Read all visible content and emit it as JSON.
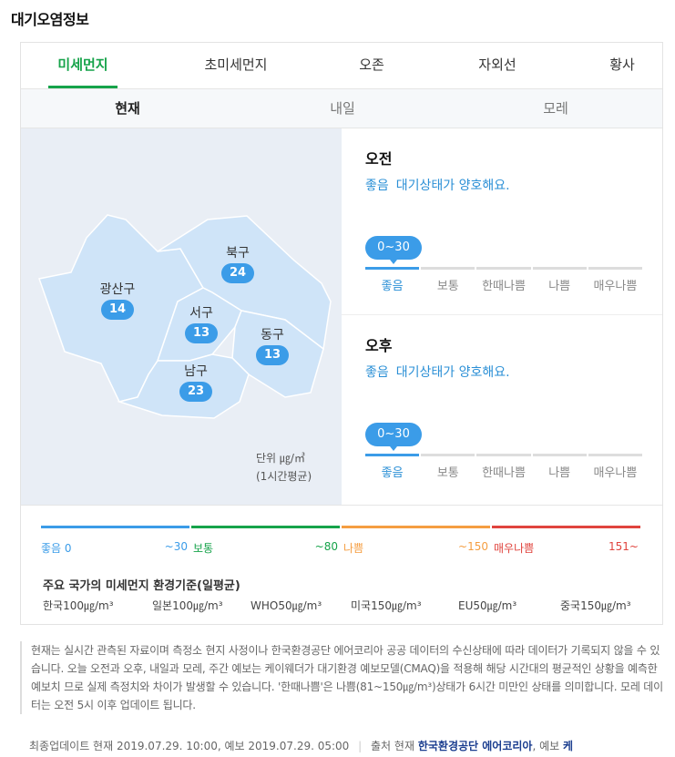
{
  "title": "대기오염정보",
  "tabs": [
    {
      "label": "미세먼지"
    },
    {
      "label": "초미세먼지"
    },
    {
      "label": "오존"
    },
    {
      "label": "자외선"
    },
    {
      "label": "황사"
    }
  ],
  "subtabs": [
    {
      "label": "현재"
    },
    {
      "label": "내일"
    },
    {
      "label": "모레"
    }
  ],
  "map": {
    "districts": [
      {
        "name": "북구",
        "value": "24"
      },
      {
        "name": "광산구",
        "value": "14"
      },
      {
        "name": "서구",
        "value": "13"
      },
      {
        "name": "동구",
        "value": "13"
      },
      {
        "name": "남구",
        "value": "23"
      }
    ],
    "unit_label": "단위 ㎍/㎥",
    "unit_note": "(1시간평균)",
    "fill_color": "#cfe4f8",
    "badge_color": "#3b9ce8"
  },
  "forecast": {
    "am": {
      "label": "오전",
      "grade": "좋음",
      "message": "대기상태가 양호해요.",
      "range": "0~30",
      "scale": [
        "좋음",
        "보통",
        "한때나쁨",
        "나쁨",
        "매우나쁨"
      ],
      "active_index": 0
    },
    "pm": {
      "label": "오후",
      "grade": "좋음",
      "message": "대기상태가 양호해요.",
      "range": "0~30",
      "scale": [
        "좋음",
        "보통",
        "한때나쁨",
        "나쁨",
        "매우나쁨"
      ],
      "active_index": 0
    }
  },
  "legend": [
    {
      "label": "좋음 0",
      "end": "~30",
      "color": "#3b9ce8"
    },
    {
      "label": "보통",
      "end": "~80",
      "color": "#16a34a"
    },
    {
      "label": "나쁨",
      "end": "~150",
      "color": "#f59e42"
    },
    {
      "label": "매우나쁨",
      "end": "151~",
      "color": "#e0443e"
    }
  ],
  "standards": {
    "title": "주요 국가의 미세먼지 환경기준(일평균)",
    "items": [
      "한국100㎍/m³",
      "일본100㎍/m³",
      "WHO50㎍/m³",
      "미국150㎍/m³",
      "EU50㎍/m³",
      "중국150㎍/m³"
    ]
  },
  "footnote": "현재는 실시간 관측된 자료이며 측정소 현지 사정이나 한국환경공단 에어코리아 공공 데이터의 수신상태에 따라 데이터가 기록되지 않을 수 있습니다. 오늘 오전과 오후, 내일과 모레, 주간 예보는 케이웨더가 대기환경 예보모델(CMAQ)을 적용해 해당 시간대의 평균적인 상황을 예측한 예보치 므로 실제 측정치와 차이가 발생할 수 있습니다. '한때나쁨'은 나쁨(81~150㎍/m³)상태가 6시간 미만인 상태를 의미합니다. 모레 데이터는 오전 5시 이후 업데이트 됩니다.",
  "update": {
    "text": "최종업데이트 현재 2019.07.29. 10:00, 예보 2019.07.29. 05:00",
    "source_prefix": "출처 현재",
    "source_link": "한국환경공단 에어코리아",
    "forecast_prefix": ", 예보",
    "forecast_link": "케"
  }
}
